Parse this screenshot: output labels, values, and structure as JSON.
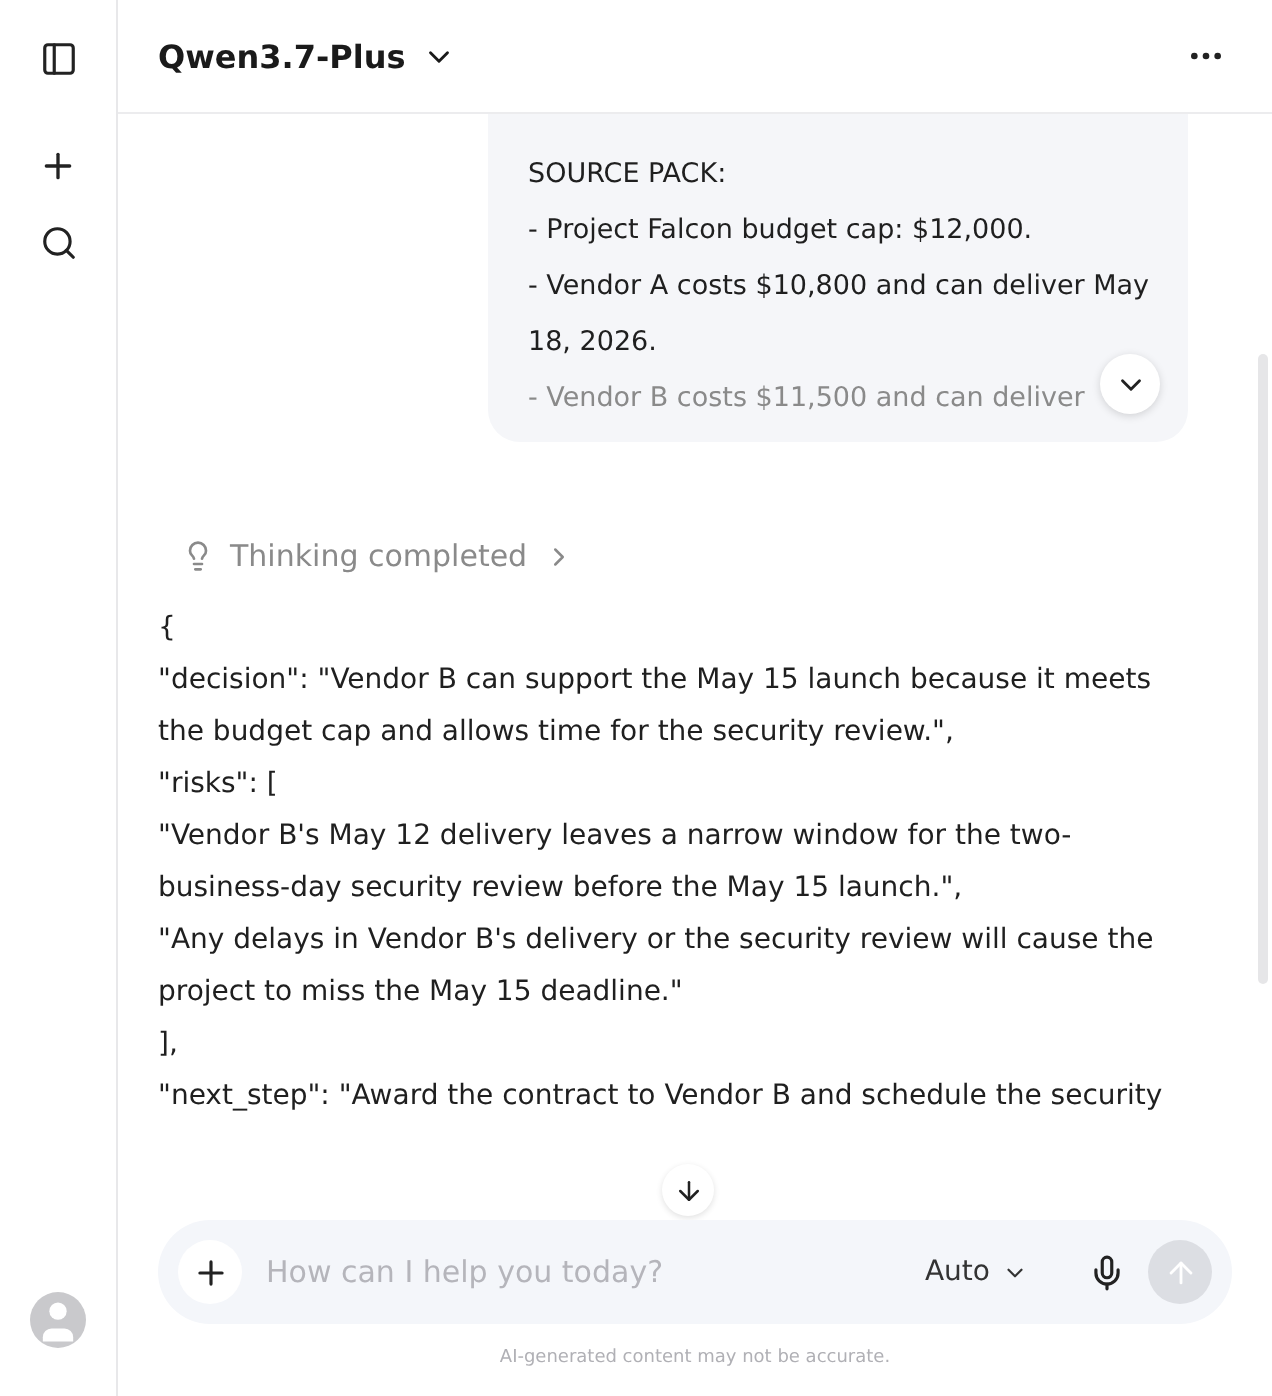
{
  "header": {
    "model": "Qwen3.7-Plus"
  },
  "user_message": {
    "lines": [
      "SOURCE PACK:",
      "- Project Falcon budget cap: $12,000.",
      "- Vendor A costs $10,800 and can deliver May 18, 2026.",
      "- Vendor B costs $11,500 and can deliver"
    ],
    "expanded": false
  },
  "thinking": {
    "label": "Thinking completed",
    "expanded": false
  },
  "answer": {
    "lines": [
      "{",
      "\"decision\": \"Vendor B can support the May 15 launch because it meets the budget cap and allows time for the security review.\",",
      "\"risks\": [",
      "\"Vendor B's May 12 delivery leaves a narrow window for the two-business-day security review before the May 15 launch.\",",
      "\"Any delays in Vendor B's delivery or the security review will cause the project to miss the May 15 deadline.\"",
      "],",
      "\"next_step\": \"Award the contract to Vendor B and schedule the security"
    ]
  },
  "composer": {
    "placeholder": "How can I help you today?",
    "mode": "Auto",
    "send_disabled": true
  },
  "footer": "AI-generated content may not be accurate."
}
